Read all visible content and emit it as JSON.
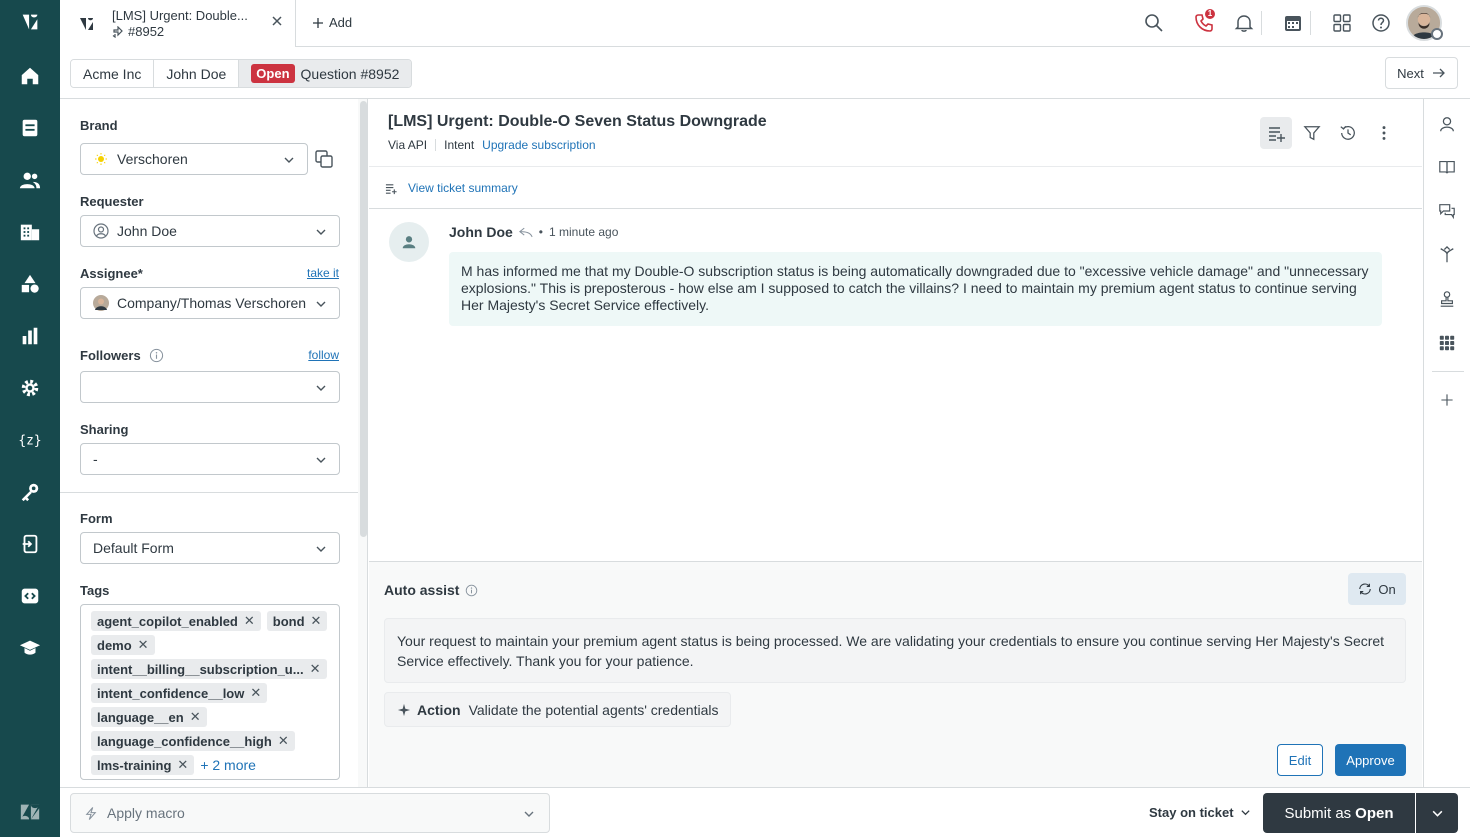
{
  "tab": {
    "title": "[LMS] Urgent: Double...",
    "ticket_id": "#8952",
    "add_label": "Add"
  },
  "top_icons": [
    "search-icon",
    "phone-icon",
    "bell-icon",
    "calendar-icon",
    "apps-icon",
    "help-icon"
  ],
  "notification_count": "1",
  "breadcrumb": {
    "organization": "Acme Inc",
    "requester": "John Doe",
    "status": "Open",
    "ticket": "Question #8952",
    "next_label": "Next"
  },
  "properties": {
    "brand_label": "Brand",
    "brand_value": "Verschoren",
    "requester_label": "Requester",
    "requester_value": "John Doe",
    "assignee_label": "Assignee*",
    "assignee_link": "take it",
    "assignee_value": "Company/Thomas Verschoren",
    "followers_label": "Followers",
    "followers_link": "follow",
    "followers_value": "",
    "sharing_label": "Sharing",
    "sharing_value": "-",
    "form_label": "Form",
    "form_value": "Default Form",
    "tags_label": "Tags",
    "tags": [
      "agent_copilot_enabled",
      "bond",
      "demo",
      "intent__billing__subscription_u...",
      "intent_confidence__low",
      "language__en",
      "language_confidence__high",
      "lms-training"
    ],
    "tags_more": "+ 2 more"
  },
  "ticket": {
    "subject": "[LMS] Urgent: Double-O Seven Status Downgrade",
    "channel": "Via API",
    "intent_label": "Intent",
    "intent_value": "Upgrade subscription",
    "summary_link": "View ticket summary"
  },
  "message": {
    "author": "John Doe",
    "time": "1 minute ago",
    "body": "M has informed me that my Double-O subscription status is being automatically downgraded due to \"excessive vehicle damage\" and \"unnecessary explosions.\" This is preposterous - how else am I supposed to catch the villains? I need to maintain my premium agent status to continue serving Her Majesty's Secret Service effectively."
  },
  "auto_assist": {
    "title": "Auto assist",
    "toggle_label": "On",
    "suggestion": "Your request to maintain your premium agent status is being processed. We are validating your credentials to ensure you continue serving Her Majesty's Secret Service effectively. Thank you for your patience.",
    "action_label": "Action",
    "action_text": "Validate the potential agents' credentials",
    "edit_label": "Edit",
    "approve_label": "Approve"
  },
  "bottom": {
    "macro_placeholder": "Apply macro",
    "stay_label": "Stay on ticket",
    "submit_prefix": "Submit as",
    "submit_status": "Open"
  },
  "colors": {
    "nav_bg": "#17494d",
    "primary": "#1f73b7",
    "open_status": "#cc3340",
    "submit_bg": "#2f3941",
    "message_bg": "#eef8f7"
  }
}
